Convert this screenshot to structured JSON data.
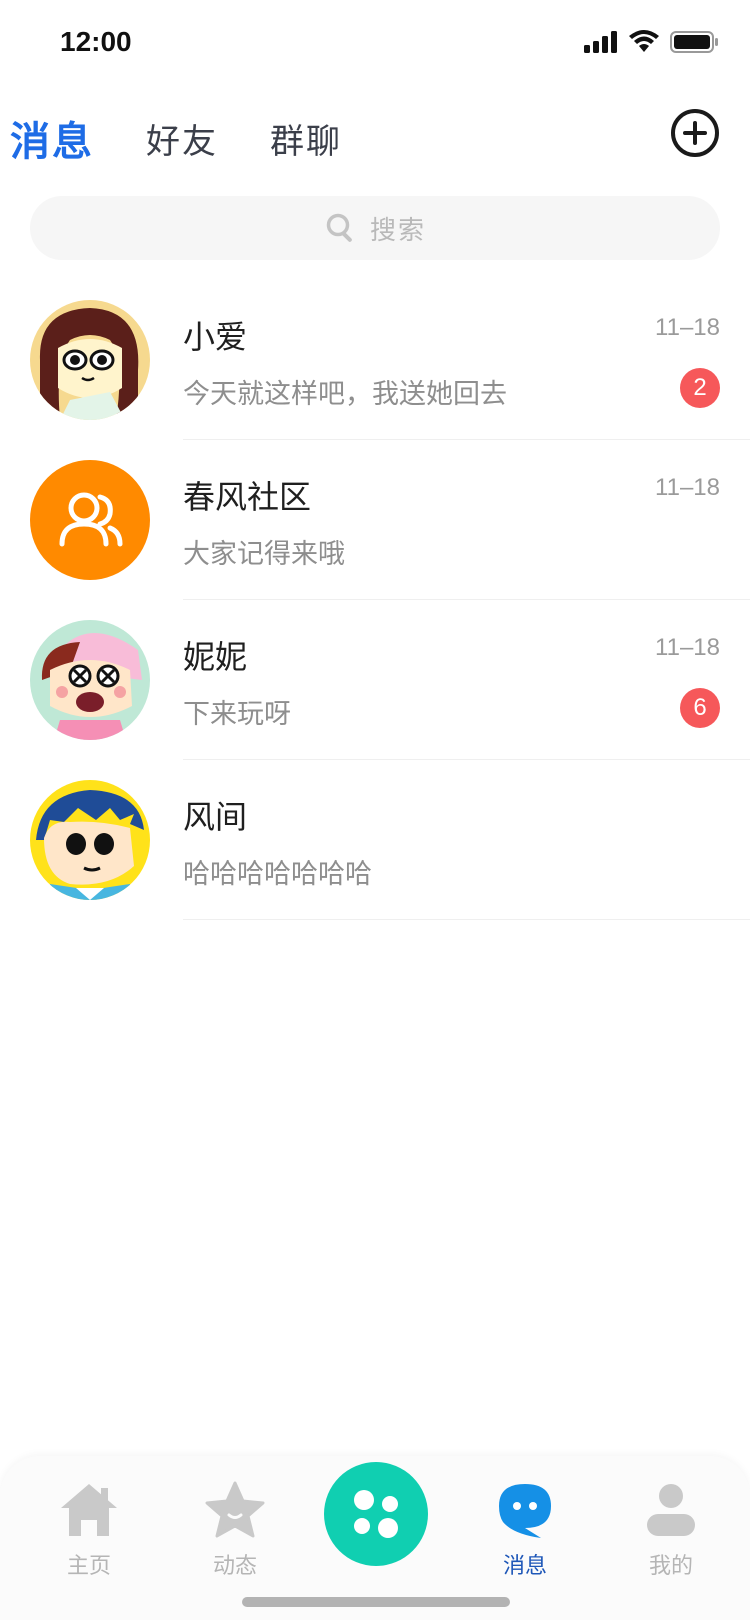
{
  "status": {
    "time": "12:00"
  },
  "tabs": [
    {
      "label": "消息",
      "active": true
    },
    {
      "label": "好友",
      "active": false
    },
    {
      "label": "群聊",
      "active": false
    }
  ],
  "search": {
    "placeholder": "搜索"
  },
  "conversations": [
    {
      "name": "小爱",
      "message": "今天就这样吧，我送她回去",
      "time": "11–18",
      "badge": "2",
      "avatar": "cartoon-girl-avatar"
    },
    {
      "name": "春风社区",
      "message": "大家记得来哦",
      "time": "11–18",
      "badge": "",
      "avatar": "group-icon"
    },
    {
      "name": "妮妮",
      "message": "下来玩呀",
      "time": "11–18",
      "badge": "6",
      "avatar": "cartoon-nene-avatar"
    },
    {
      "name": "风间",
      "message": "哈哈哈哈哈哈哈",
      "time": "",
      "badge": "",
      "avatar": "cartoon-kazama-avatar"
    }
  ],
  "bottom_nav": [
    {
      "label": "主页",
      "icon": "home-icon",
      "active": false
    },
    {
      "label": "动态",
      "icon": "star-icon",
      "active": false
    },
    {
      "label": "消息",
      "icon": "chat-icon",
      "active": true
    },
    {
      "label": "我的",
      "icon": "person-icon",
      "active": false
    }
  ],
  "colors": {
    "accent": "#1e6ce6",
    "badge": "#f6585a",
    "center_button": "#10cfb1",
    "group_avatar": "#ff8a00",
    "nav_active": "#1e57b8"
  }
}
